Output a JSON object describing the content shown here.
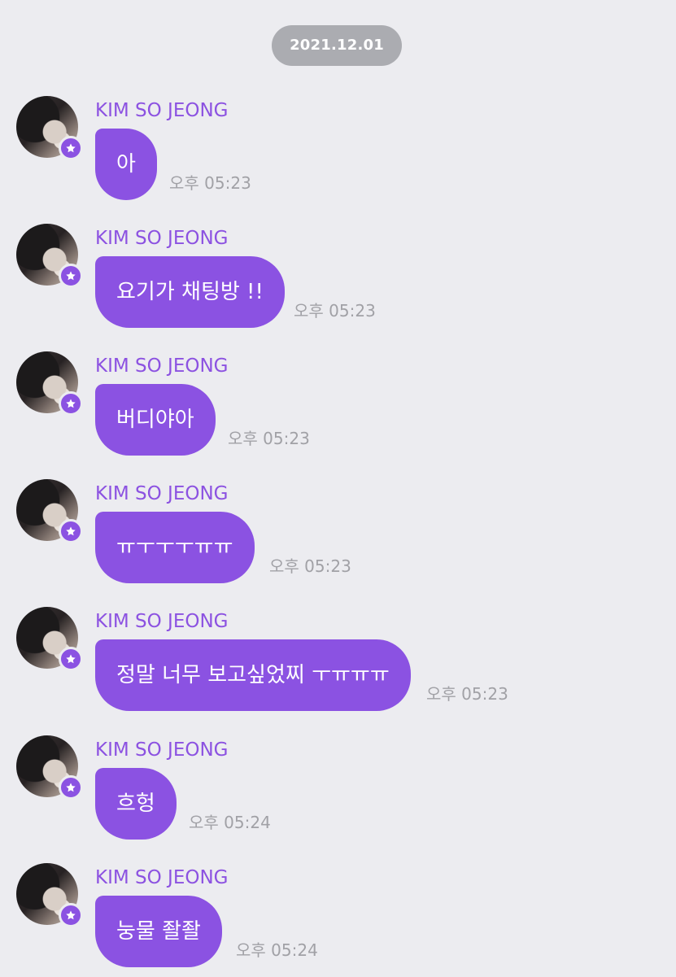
{
  "chat": {
    "date": "2021.12.01",
    "messages": [
      {
        "sender": "KIM SO JEONG",
        "text": "아",
        "time": "오후 05:23"
      },
      {
        "sender": "KIM SO JEONG",
        "text": "요기가 채팅방 !!",
        "time": "오후 05:23"
      },
      {
        "sender": "KIM SO JEONG",
        "text": "버디야아",
        "time": "오후 05:23"
      },
      {
        "sender": "KIM SO JEONG",
        "text": "ㅠㅜㅜㅜㅠㅠ",
        "time": "오후 05:23"
      },
      {
        "sender": "KIM SO JEONG",
        "text": "정말 너무 보고싶었찌 ㅜㅠㅠㅠ",
        "time": "오후 05:23"
      },
      {
        "sender": "KIM SO JEONG",
        "text": "흐헝",
        "time": "오후 05:24"
      },
      {
        "sender": "KIM SO JEONG",
        "text": "눙물 좔좔",
        "time": "오후 05:24"
      }
    ]
  },
  "theme": {
    "background": "#ececf0",
    "accent": "#8b52e2",
    "date_pill": "#abacb1",
    "time_text": "#a1a1a6"
  },
  "icons": {
    "badge": "star-icon",
    "avatar": "profile-photo"
  }
}
